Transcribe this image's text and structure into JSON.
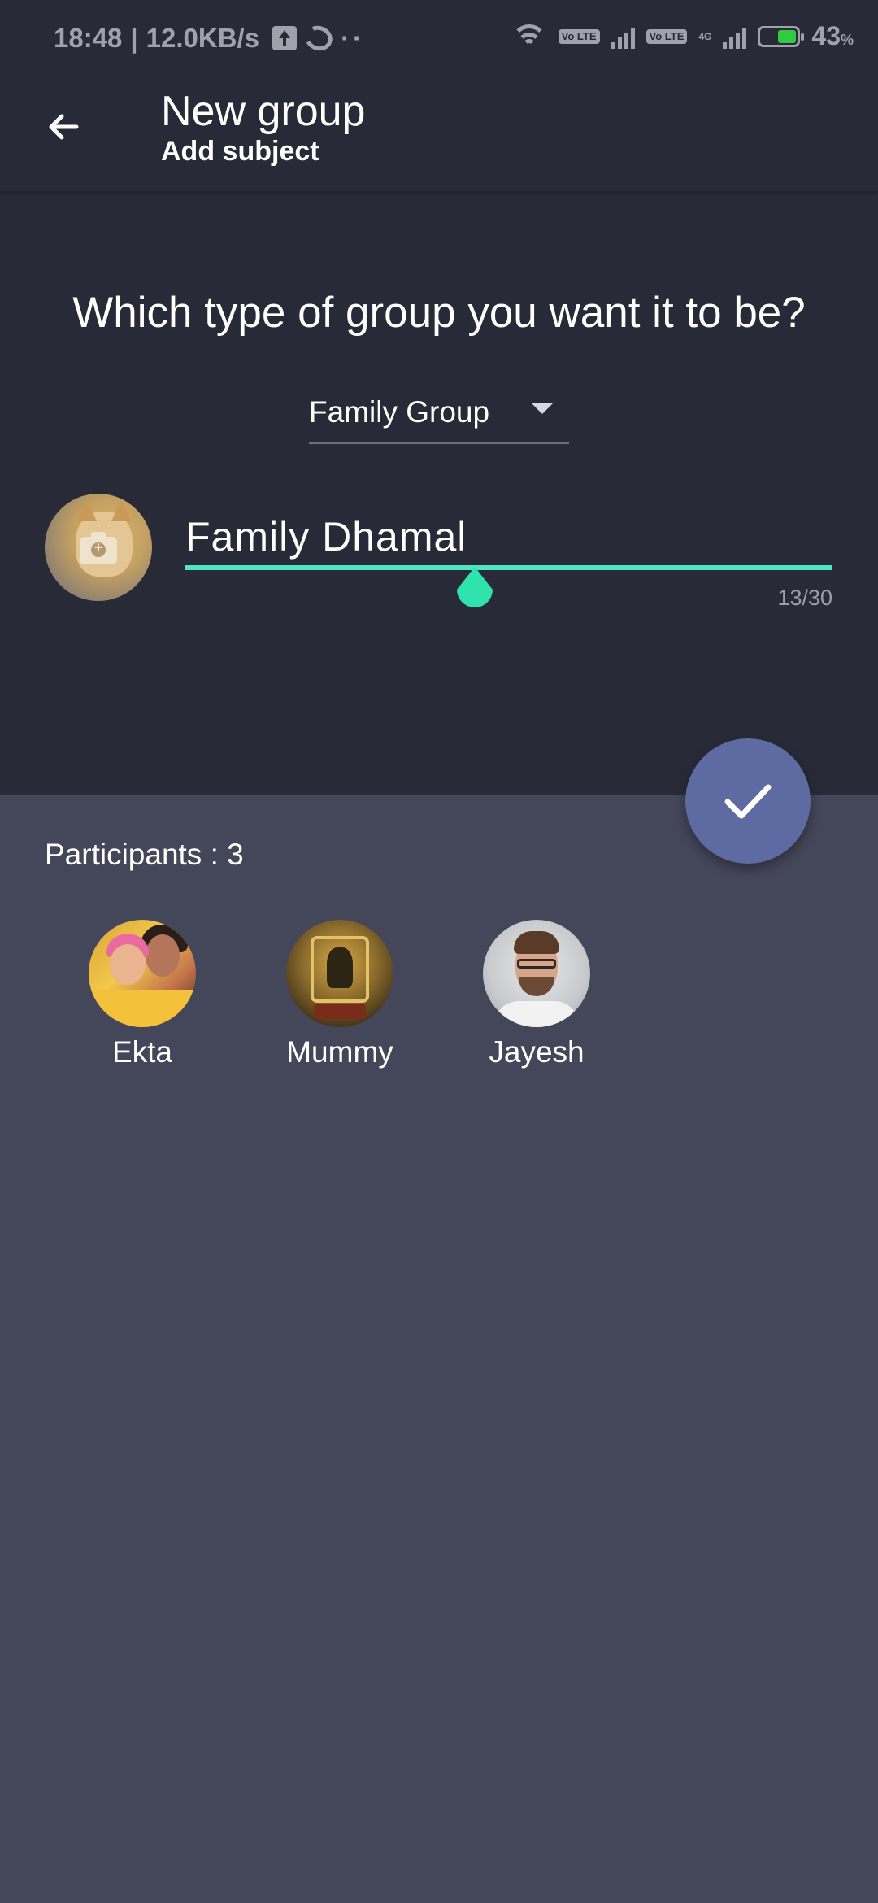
{
  "status_bar": {
    "time": "18:48",
    "separator": "|",
    "speed": "12.0KB/s",
    "dots": "··",
    "volte_1": "Vo LTE",
    "volte_2": "Vo LTE",
    "network_badge": "4G",
    "battery_percent": "43",
    "battery_symbol": "%"
  },
  "toolbar": {
    "title": "New group",
    "subtitle": "Add subject"
  },
  "group_type": {
    "question": "Which type of group you want it to be?",
    "selected": "Family Group"
  },
  "subject": {
    "value": "Family Dhamal",
    "counter": "13/30"
  },
  "participants": {
    "label": "Participants : 3",
    "items": [
      {
        "name": "Ekta"
      },
      {
        "name": "Mummy"
      },
      {
        "name": "Jayesh"
      }
    ]
  },
  "colors": {
    "accent": "#4ee6c3",
    "fab": "#5e6ba3",
    "header_bg": "#282a37",
    "body_bg": "#444659"
  }
}
